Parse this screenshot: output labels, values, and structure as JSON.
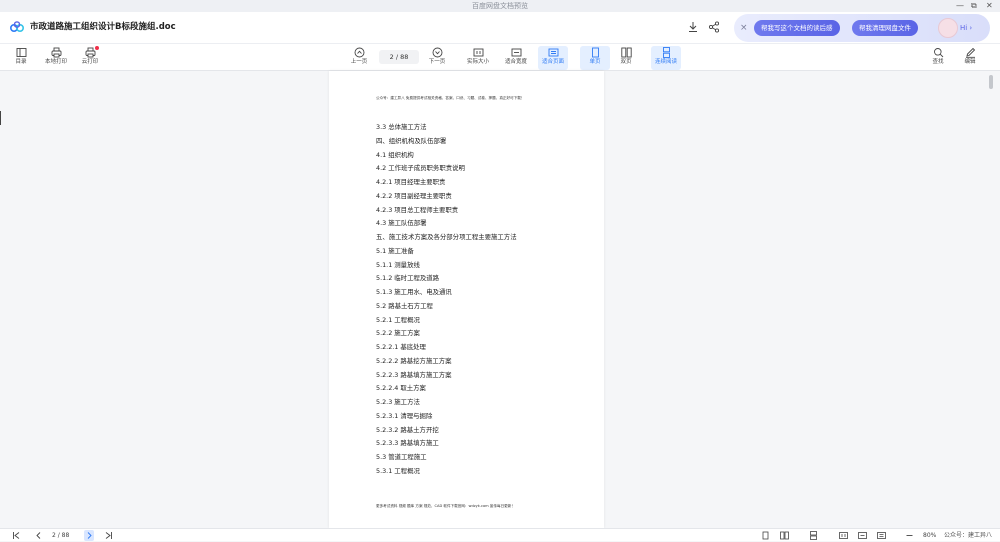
{
  "window": {
    "title": "百度网盘文档预览",
    "controls": [
      "—",
      "⧉",
      "✕"
    ]
  },
  "header": {
    "doc_title": "市政道路施工组织设计B标段施组.doc",
    "ai": {
      "close": "×",
      "btn_write": "帮我写这个文档的读后感",
      "btn_clean": "帮我清理网盘文件",
      "hi": "Hi ›"
    }
  },
  "toolbar": {
    "catalog": "目录",
    "local_print": "本地打印",
    "cloud_print": "云打印",
    "prev": "上一页",
    "page_indicator": "2  / 88",
    "next": "下一页",
    "actual_size": "实际大小",
    "fit_width": "适合宽度",
    "fit_page": "适合页面",
    "single_page": "单页",
    "double_page": "双页",
    "continuous": "连续阅读",
    "search": "查找",
    "edit": "编辑"
  },
  "document": {
    "header_text": "公众号：建工异八 免费提供考试相关资格、答案、口诀、习题、试卷、押题、真正好可下载！",
    "toc": [
      "3.3 总体施工方法",
      "四、组织机构及队伍部署",
      "4.1 组织机构",
      "4.2 工作班子成员职务职责说明",
      "4.2.1 项目经理主要职责",
      "4.2.2 项目副经理主要职责",
      "4.2.3 项目总工程师主要职责",
      "4.3 施工队伍部署",
      "五、施工技术方案及各分部分项工程主要施工方法",
      "5.1 施工准备",
      "5.1.1 测量放线",
      "5.1.2 临时工程及道路",
      "5.1.3 施工用水、电及通讯",
      "5.2 路基土石方工程",
      "5.2.1 工程概况",
      "5.2.2 施工方案",
      "5.2.2.1 基底处理",
      "5.2.2.2 路基挖方施工方案",
      "5.2.2.3 路基填方施工方案",
      "5.2.2.4 取土方案",
      "5.2.3 施工方法",
      "5.2.3.1 清理与掘除",
      "5.2.3.2 路基土方开挖",
      "5.2.3.3 路基填方施工",
      "5.3 管道工程施工",
      "5.3.1  工程概况"
    ],
    "footer_text": "更多考试资料 视频 题库 方案 规范，CAD 软件下载官网：wdzyk.com 宣传每日更新！"
  },
  "status": {
    "page_indicator": "2  / 88",
    "zoom": "80%",
    "watermark": "公众号：建工异八"
  },
  "colors": {
    "accent": "#2f7bf5",
    "ai_pill": "#5a64e6",
    "notify_dot": "#f0304a"
  }
}
